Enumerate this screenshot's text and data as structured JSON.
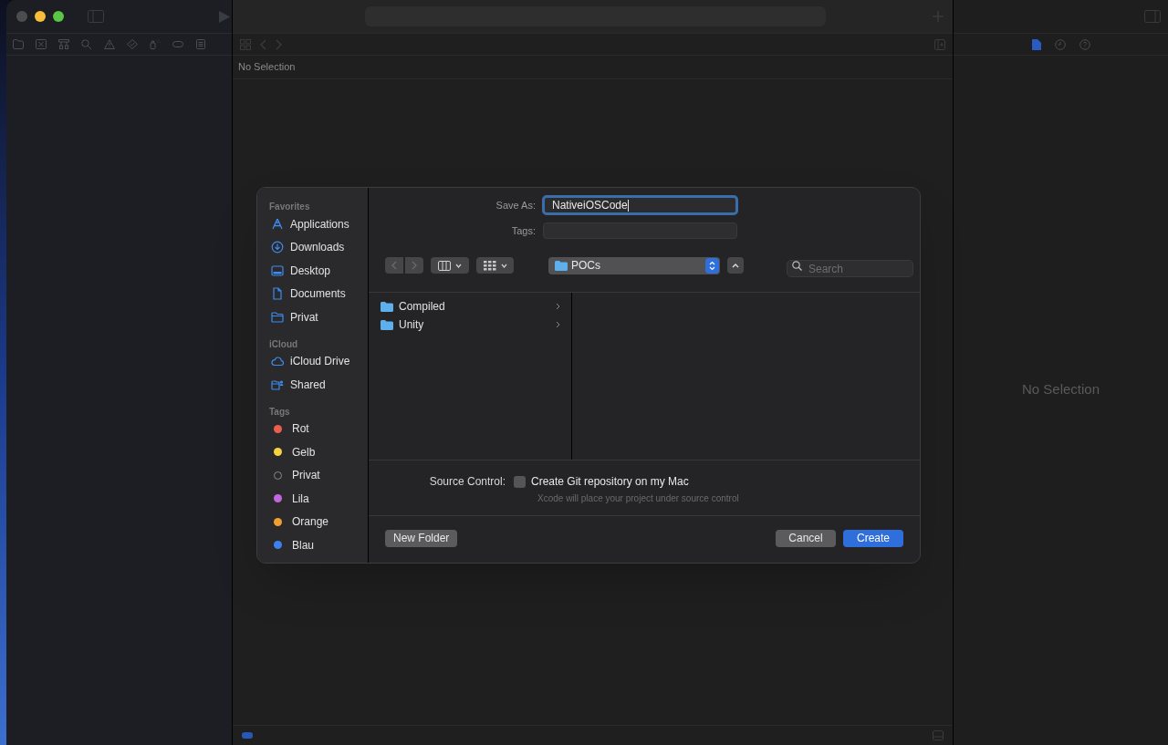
{
  "editor": {
    "jump_bar": "No Selection"
  },
  "inspector": {
    "empty_text": "No Selection"
  },
  "dialog": {
    "sidebar": [
      {
        "heading": "Favorites",
        "items": [
          {
            "label": "Applications",
            "kind": "applications"
          },
          {
            "label": "Downloads",
            "kind": "downloads"
          },
          {
            "label": "Desktop",
            "kind": "desktop"
          },
          {
            "label": "Documents",
            "kind": "document"
          },
          {
            "label": "Privat",
            "kind": "folder"
          }
        ]
      },
      {
        "heading": "iCloud",
        "items": [
          {
            "label": "iCloud Drive",
            "kind": "cloud"
          },
          {
            "label": "Shared",
            "kind": "shared"
          }
        ]
      },
      {
        "heading": "Tags",
        "items": [
          {
            "label": "Rot",
            "kind": "tag",
            "color": "#ec5f4f"
          },
          {
            "label": "Gelb",
            "kind": "tag",
            "color": "#f5d33f"
          },
          {
            "label": "Privat",
            "kind": "tag-empty"
          },
          {
            "label": "Lila",
            "kind": "tag",
            "color": "#c367e0"
          },
          {
            "label": "Orange",
            "kind": "tag",
            "color": "#f0a02f"
          },
          {
            "label": "Blau",
            "kind": "tag",
            "color": "#3b82f0"
          }
        ]
      }
    ],
    "save_as": {
      "label": "Save As:",
      "value": "NativeiOSCode",
      "focused": true
    },
    "tags_field": {
      "label": "Tags:"
    },
    "navigation": {
      "back_disabled": true,
      "forward_disabled": true
    },
    "location": {
      "value": "POCs"
    },
    "search": {
      "placeholder": "Search"
    },
    "files": [
      {
        "name": "Compiled"
      },
      {
        "name": "Unity"
      }
    ],
    "source_control": {
      "label": "Source Control:",
      "checkbox": {
        "label": "Create Git repository on my Mac",
        "checked": false
      },
      "hint": "Xcode will place your project under source control"
    },
    "buttons": [
      {
        "label": "New Folder",
        "kind": "secondary"
      },
      {
        "label": "Cancel",
        "kind": "secondary"
      },
      {
        "label": "Create",
        "kind": "default"
      }
    ]
  }
}
